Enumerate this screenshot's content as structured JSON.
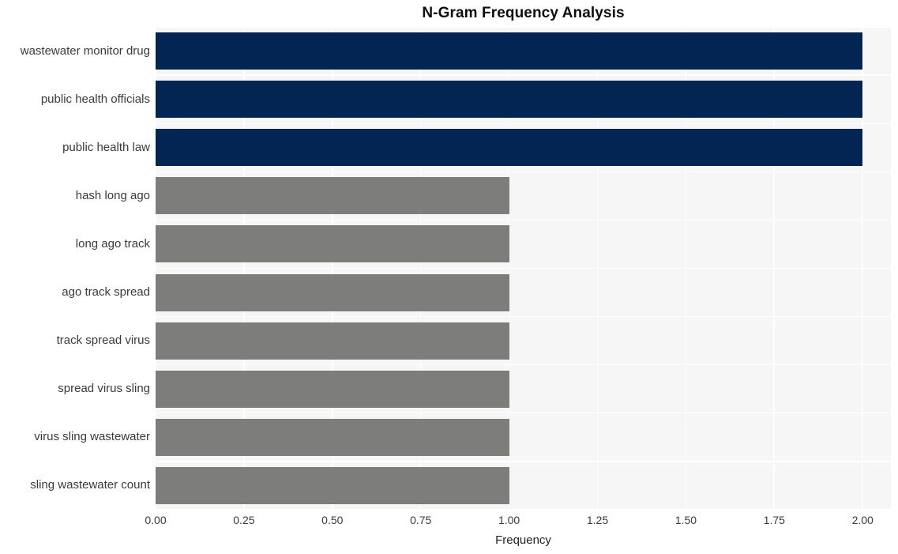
{
  "chart_data": {
    "type": "bar",
    "orientation": "horizontal",
    "title": "N-Gram Frequency Analysis",
    "xlabel": "Frequency",
    "ylabel": "",
    "categories": [
      "wastewater monitor drug",
      "public health officials",
      "public health law",
      "hash long ago",
      "long ago track",
      "ago track spread",
      "track spread virus",
      "spread virus sling",
      "virus sling wastewater",
      "sling wastewater count"
    ],
    "values": [
      2,
      2,
      2,
      1,
      1,
      1,
      1,
      1,
      1,
      1
    ],
    "bar_colors": [
      "#032553",
      "#032553",
      "#032553",
      "#7d7d7b",
      "#7d7d7b",
      "#7d7d7b",
      "#7d7d7b",
      "#7d7d7b",
      "#7d7d7b",
      "#7d7d7b"
    ],
    "xlim": [
      0,
      2.08
    ],
    "xticks": [
      0,
      0.25,
      0.5,
      0.75,
      1,
      1.25,
      1.5,
      1.75,
      2
    ],
    "xtick_labels": [
      "0.00",
      "0.25",
      "0.50",
      "0.75",
      "1.00",
      "1.25",
      "1.50",
      "1.75",
      "2.00"
    ],
    "grid": true,
    "legend": null,
    "plot_background": "#f6f6f6",
    "grid_color": "#ffffff",
    "figure_background": "#ffffff"
  }
}
